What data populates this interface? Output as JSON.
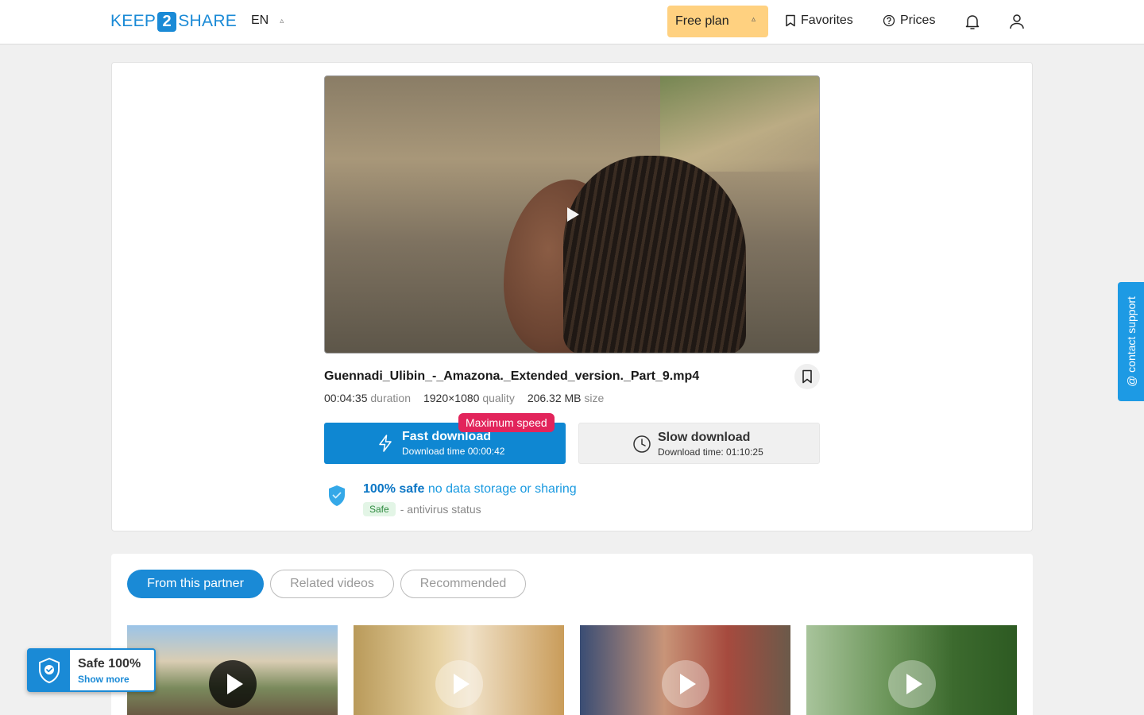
{
  "header": {
    "logo_left": "KEEP",
    "logo_num": "2",
    "logo_right": "SHARE",
    "language": "EN",
    "plan_label": "Free plan",
    "favorites_label": "Favorites",
    "prices_label": "Prices"
  },
  "file": {
    "name": "Guennadi_Ulibin_-_Amazona._Extended_version._Part_9.mp4",
    "duration_value": "00:04:35",
    "duration_label": "duration",
    "quality_value": "1920×1080",
    "quality_label": "quality",
    "size_value": "206.32 MB",
    "size_label": "size"
  },
  "download": {
    "badge": "Maximum speed",
    "fast_title": "Fast download",
    "fast_sub": "Download time 00:00:42",
    "slow_title": "Slow download",
    "slow_sub": "Download time: 01:10:25"
  },
  "safety": {
    "strong": "100% safe",
    "light": "no data storage or sharing",
    "status_pill": "Safe",
    "status_text": "- antivirus status"
  },
  "support_label": "@ contact support",
  "tabs": [
    {
      "label": "From this partner",
      "active": true
    },
    {
      "label": "Related videos",
      "active": false
    },
    {
      "label": "Recommended",
      "active": false
    }
  ],
  "safe_badge": {
    "title": "Safe 100%",
    "link": "Show more"
  },
  "colors": {
    "brand": "#1a8ad6",
    "plan_bg": "#ffd180",
    "badge_red": "#e2245b",
    "fast_bg": "#0f87d2"
  }
}
